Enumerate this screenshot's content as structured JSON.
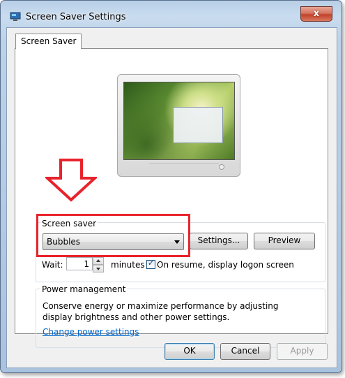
{
  "window": {
    "title": "Screen Saver Settings",
    "close_glyph": "x"
  },
  "tabs": [
    {
      "label": "Screen Saver",
      "active": true
    }
  ],
  "screen_saver": {
    "group_label": "Screen saver",
    "selected": "Bubbles",
    "settings_button": "Settings...",
    "preview_button": "Preview",
    "wait_label": "Wait:",
    "wait_value": "1",
    "minutes_label": "minutes",
    "on_resume_checked": true,
    "on_resume_label": "On resume, display logon screen"
  },
  "power": {
    "group_label": "Power management",
    "description": "Conserve energy or maximize performance by adjusting display brightness and other power settings.",
    "link": "Change power settings"
  },
  "footer": {
    "ok": "OK",
    "cancel": "Cancel",
    "apply": "Apply"
  },
  "colors": {
    "annotation_red": "#e8232b",
    "link_blue": "#0066cc"
  },
  "icons": {
    "app": "display-icon",
    "annotation": "down-arrow-annotation"
  }
}
